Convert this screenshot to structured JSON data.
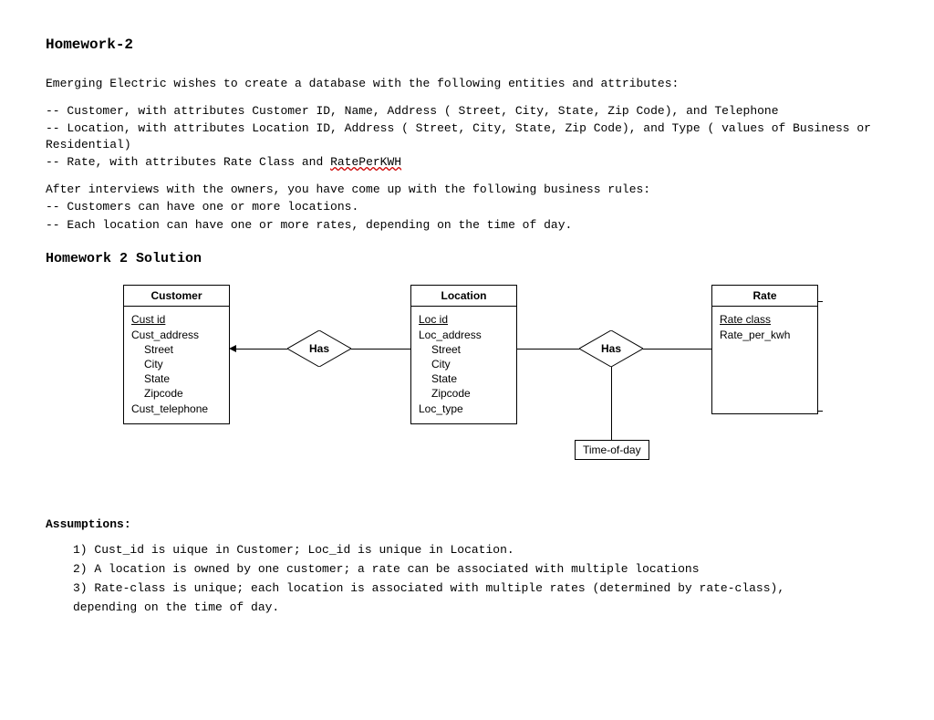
{
  "title": "Homework-2",
  "intro": {
    "line1": "Emerging Electric wishes to create a database with the following entities and attributes:",
    "line2": "-- Customer, with attributes Customer ID, Name, Address ( Street, City, State, Zip Code), and Telephone",
    "line3": "-- Location, with attributes Location ID, Address ( Street, City, State, Zip Code), and Type ( values of Business or Residential)",
    "line4a": "-- Rate, with attributes Rate Class and ",
    "line4b": "RatePerKWH",
    "line5": "After interviews with the owners, you have come up with the following business rules:",
    "line6": "-- Customers can have one or more locations.",
    "line7": "-- Each location can have one or more rates, depending on the time of day."
  },
  "solution_title": "Homework 2 Solution",
  "diagram": {
    "customer": {
      "title": "Customer",
      "attrs": {
        "pk": "Cust  id",
        "addr": "Cust_address",
        "street": "Street",
        "city": "City",
        "state": "State",
        "zip": "Zipcode",
        "tel": "Cust_telephone"
      }
    },
    "location": {
      "title": "Location",
      "attrs": {
        "pk": "Loc  id",
        "addr": "Loc_address",
        "street": "Street",
        "city": "City",
        "state": "State",
        "zip": "Zipcode",
        "type": "Loc_type"
      }
    },
    "rate": {
      "title": "Rate",
      "attrs": {
        "pk": "Rate  class",
        "rpk": "Rate_per_kwh"
      }
    },
    "rel1": "Has",
    "rel2": "Has",
    "rel2_attr": "Time-of-day"
  },
  "assumptions": {
    "title": "Assumptions:",
    "a1": "1) Cust_id is uique in Customer; Loc_id is unique in Location.",
    "a2": "2) A location is owned by one customer; a rate can be associated with multiple locations",
    "a3": "3) Rate-class is unique; each location is associated with multiple rates (determined by rate-class),",
    "a3b": "depending on the time of day."
  }
}
